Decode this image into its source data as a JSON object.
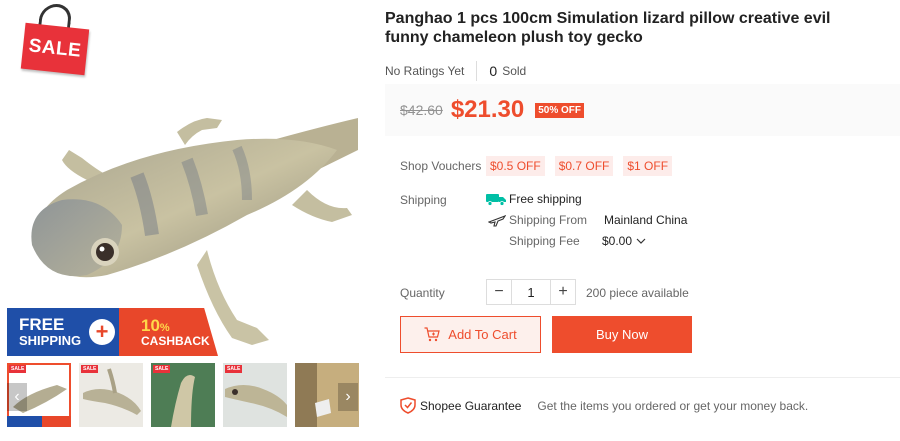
{
  "gallery": {
    "sale_badge": "SALE",
    "promo": {
      "free_line1": "FREE",
      "free_line2": "SHIPPING",
      "plus": "+",
      "cashback_pct": "10",
      "cashback_pct_sign": "%",
      "cashback_label": "CASHBACK"
    },
    "thumb_count": 5,
    "thumb_badge": "SALE",
    "prev_icon": "chevron-left-icon",
    "next_icon": "chevron-right-icon"
  },
  "product": {
    "title": "Panghao 1 pcs 100cm Simulation lizard pillow creative evil funny chameleon plush toy gecko",
    "ratings_text": "No Ratings Yet",
    "sold_count": "0",
    "sold_label": "Sold"
  },
  "price": {
    "original": "$42.60",
    "current": "$21.30",
    "discount": "50% OFF"
  },
  "vouchers": {
    "label": "Shop Vouchers",
    "items": [
      "$0.5 OFF",
      "$0.7 OFF",
      "$1 OFF"
    ]
  },
  "shipping": {
    "label": "Shipping",
    "free_text": "Free shipping",
    "from_label": "Shipping From",
    "from_value": "Mainland China",
    "fee_label": "Shipping Fee",
    "fee_value": "$0.00"
  },
  "quantity": {
    "label": "Quantity",
    "minus": "−",
    "value": "1",
    "plus": "+",
    "available": "200 piece available"
  },
  "actions": {
    "add_to_cart": "Add To Cart",
    "buy_now": "Buy Now"
  },
  "guarantee": {
    "title": "Shopee Guarantee",
    "text": "Get the items you ordered or get your money back."
  },
  "colors": {
    "accent": "#ee4d2d",
    "voucher_bg": "#fdecea",
    "free_ship_teal": "#00bfa5"
  }
}
